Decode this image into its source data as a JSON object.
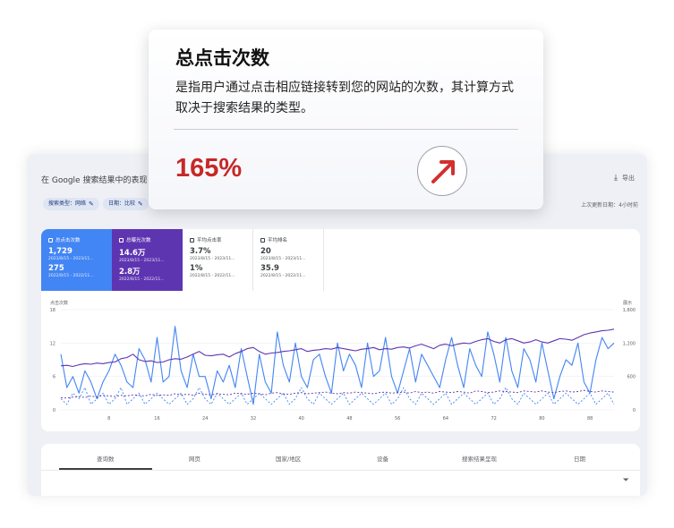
{
  "dashboard": {
    "title": "在 Google 搜索结果中的表现",
    "export_label": "导出",
    "filters": [
      {
        "label": "搜索类型：网络"
      },
      {
        "label": "日期：比较"
      }
    ],
    "last_updated": "上次更新日期：4小时前",
    "metrics": [
      {
        "label": "总点击次数",
        "value": "1,729",
        "date": "2023/8/15 - 2023/11...",
        "value2": "275",
        "date2": "2022/8/15 - 2022/11..."
      },
      {
        "label": "总曝光次数",
        "value": "14.6万",
        "date": "2023/8/15 - 2023/11...",
        "value2": "2.8万",
        "date2": "2022/8/15 - 2022/11..."
      },
      {
        "label": "平均点击率",
        "value": "3.7%",
        "date": "2023/8/15 - 2023/11...",
        "value2": "1%",
        "date2": "2022/8/15 - 2022/11..."
      },
      {
        "label": "平均排名",
        "value": "20",
        "date": "2023/8/15 - 2023/11...",
        "value2": "35.9",
        "date2": "2022/8/15 - 2022/11..."
      }
    ],
    "tabs": [
      "查询数",
      "网页",
      "国家/地区",
      "设备",
      "搜索结果呈现",
      "日期"
    ],
    "active_tab": 0
  },
  "chart_data": {
    "type": "line",
    "ylabel_left": "点击次数",
    "ylabel_right": "展示",
    "yticks_left": [
      "18",
      "12",
      "6",
      "0"
    ],
    "yticks_right": [
      "1,800",
      "1,200",
      "600",
      "0"
    ],
    "ylim_left": [
      0,
      18
    ],
    "ylim_right": [
      0,
      1800
    ],
    "x_ticks": [
      "8",
      "16",
      "24",
      "32",
      "40",
      "48",
      "56",
      "64",
      "72",
      "80",
      "88"
    ],
    "x_count": 93,
    "series": [
      {
        "axis": "left",
        "color": "#4285f4",
        "style": "solid",
        "values": [
          10,
          4,
          6,
          3,
          7,
          5,
          2,
          5,
          7,
          10,
          8,
          5,
          4,
          11,
          9,
          5,
          13,
          5,
          6,
          15,
          7,
          4,
          10,
          6,
          6,
          2,
          7,
          5,
          8,
          4,
          11,
          6,
          1,
          10,
          5,
          3,
          14,
          8,
          5,
          12,
          6,
          4,
          9,
          10,
          6,
          3,
          12,
          7,
          10,
          8,
          4,
          12,
          6,
          7,
          13,
          6,
          3,
          7,
          11,
          5,
          10,
          8,
          6,
          4,
          9,
          13,
          8,
          4,
          11,
          8,
          6,
          14,
          10,
          5,
          13,
          7,
          4,
          11,
          9,
          5,
          12,
          7,
          2,
          6,
          9,
          8,
          12,
          5,
          3,
          9,
          13,
          11,
          12
        ]
      },
      {
        "axis": "left",
        "color": "#4285f4",
        "style": "dashed",
        "values": [
          2,
          1,
          3,
          2,
          4,
          1,
          2,
          3,
          1,
          2,
          4,
          1,
          2,
          3,
          1,
          2,
          3,
          2,
          1,
          2,
          3,
          1,
          2,
          4,
          2,
          1,
          3,
          2,
          1,
          2,
          3,
          1,
          2,
          3,
          2,
          1,
          2,
          3,
          1,
          2,
          4,
          2,
          1,
          3,
          2,
          1,
          2,
          3,
          1,
          2,
          3,
          2,
          1,
          2,
          3,
          1,
          2,
          4,
          2,
          1,
          3,
          2,
          1,
          2,
          3,
          1,
          2,
          3,
          2,
          1,
          2,
          3,
          1,
          2,
          4,
          2,
          1,
          3,
          2,
          1,
          2,
          3,
          1,
          2,
          3,
          2,
          1,
          2,
          3,
          1,
          2,
          3,
          1
        ]
      },
      {
        "axis": "right",
        "color": "#5e35b1",
        "style": "solid",
        "values": [
          790,
          800,
          780,
          810,
          830,
          820,
          840,
          830,
          850,
          860,
          920,
          940,
          1000,
          900,
          870,
          880,
          850,
          860,
          900,
          920,
          910,
          950,
          1000,
          1050,
          980,
          970,
          990,
          1000,
          950,
          1010,
          1050,
          1100,
          1120,
          1050,
          1000,
          1020,
          1030,
          1050,
          1060,
          1080,
          1100,
          1050,
          1070,
          1080,
          1100,
          1090,
          1120,
          1100,
          1080,
          1060,
          1090,
          1100,
          1120,
          1080,
          1100,
          1090,
          1120,
          1130,
          1110,
          1150,
          1180,
          1140,
          1100,
          1160,
          1180,
          1150,
          1180,
          1200,
          1190,
          1230,
          1260,
          1280,
          1230,
          1200,
          1260,
          1280,
          1240,
          1200,
          1220,
          1260,
          1220,
          1200,
          1240,
          1280,
          1270,
          1250,
          1300,
          1350,
          1380,
          1400,
          1420,
          1430,
          1450
        ]
      },
      {
        "axis": "right",
        "color": "#5e35b1",
        "style": "dashed",
        "values": [
          220,
          210,
          230,
          240,
          220,
          250,
          230,
          260,
          250,
          240,
          260,
          250,
          270,
          260,
          250,
          280,
          260,
          270,
          260,
          290,
          270,
          280,
          260,
          300,
          280,
          270,
          290,
          280,
          270,
          300,
          290,
          280,
          300,
          290,
          270,
          300,
          310,
          290,
          280,
          300,
          310,
          290,
          300,
          310,
          320,
          300,
          290,
          310,
          300,
          320,
          310,
          300,
          290,
          310,
          320,
          300,
          310,
          320,
          300,
          330,
          310,
          320,
          300,
          330,
          320,
          310,
          330,
          320,
          300,
          340,
          330,
          310,
          320,
          340,
          330,
          320,
          310,
          340,
          330,
          320,
          340,
          320,
          310,
          330,
          340,
          320,
          330,
          350,
          330,
          320,
          340,
          330,
          320
        ]
      }
    ]
  },
  "tooltip": {
    "title": "总点击次数",
    "description": "是指用户通过点击相应链接转到您的网站的次数，其计算方式取决于搜索结果的类型。",
    "value": "165%",
    "trend_icon": "arrow-up-right-icon",
    "value_color": "#c62828"
  }
}
